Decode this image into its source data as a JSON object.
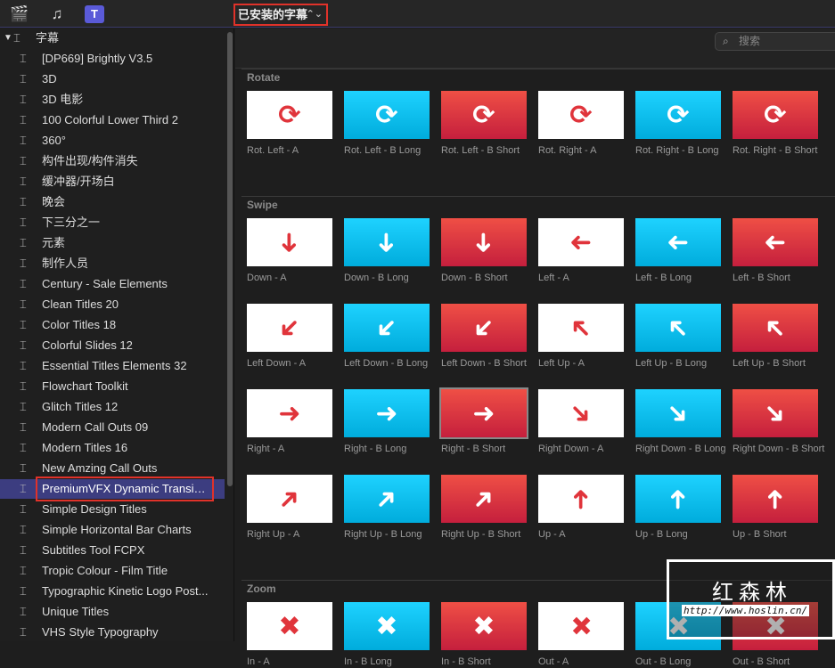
{
  "toolbar": {
    "icons": [
      "clapper-icon",
      "music-photo-icon",
      "titles-icon"
    ],
    "library_select": "已安装的字幕"
  },
  "sidebar": {
    "root": "字幕",
    "selected_index": 21,
    "items": [
      "[DP669] Brightly V3.5",
      "3D",
      "3D 电影",
      "100 Colorful Lower Third 2",
      "360°",
      "构件出现/构件消失",
      "缓冲器/开场白",
      "晚会",
      "下三分之一",
      "元素",
      "制作人员",
      "Century - Sale Elements",
      "Clean Titles 20",
      "Color Titles 18",
      "Colorful Slides 12",
      "Essential Titles Elements 32",
      "Flowchart Toolkit",
      "Glitch Titles 12",
      "Modern Call Outs 09",
      "Modern Titles 16",
      "New Amzing Call Outs",
      "PremiumVFX Dynamic Transiti...",
      "Simple Design Titles",
      "Simple Horizontal Bar Charts",
      "Subtitles Tool FCPX",
      "Tropic Colour - Film Title",
      "Typographic Kinetic Logo Post...",
      "Unique Titles",
      "VHS Style Typography"
    ]
  },
  "search": {
    "placeholder": "搜索"
  },
  "sections": [
    {
      "title": "Rotate",
      "items": [
        [
          "Rot. Left - A",
          "rotate"
        ],
        [
          "Rot. Left - B Long",
          "rotate"
        ],
        [
          "Rot. Left - B Short",
          "rotate"
        ],
        [
          "Rot. Right - A",
          "rotate"
        ],
        [
          "Rot. Right - B Long",
          "rotate"
        ],
        [
          "Rot. Right - B Short",
          "rotate"
        ]
      ]
    },
    {
      "title": "Swipe",
      "items": [
        [
          "Down - A",
          "down"
        ],
        [
          "Down - B Long",
          "down"
        ],
        [
          "Down - B Short",
          "down"
        ],
        [
          "Left - A",
          "left"
        ],
        [
          "Left - B Long",
          "left"
        ],
        [
          "Left - B Short",
          "left"
        ],
        [
          "Left Down - A",
          "left-down"
        ],
        [
          "Left Down - B Long",
          "left-down"
        ],
        [
          "Left Down - B Short",
          "left-down"
        ],
        [
          "Left Up - A",
          "left-up"
        ],
        [
          "Left Up - B Long",
          "left-up"
        ],
        [
          "Left Up - B Short",
          "left-up"
        ],
        [
          "Right - A",
          "right"
        ],
        [
          "Right - B Long",
          "right"
        ],
        [
          "Right - B Short",
          "right"
        ],
        [
          "Right Down - A",
          "right-down"
        ],
        [
          "Right Down - B Long",
          "right-down"
        ],
        [
          "Right Down - B Short",
          "right-down"
        ],
        [
          "Right Up - A",
          "right-up"
        ],
        [
          "Right Up - B Long",
          "right-up"
        ],
        [
          "Right Up - B Short",
          "right-up"
        ],
        [
          "Up - A",
          "up"
        ],
        [
          "Up - B Long",
          "up"
        ],
        [
          "Up - B Short",
          "up"
        ]
      ]
    },
    {
      "title": "Zoom",
      "items": [
        [
          "In - A",
          "in"
        ],
        [
          "In - B Long",
          "in"
        ],
        [
          "In - B Short",
          "in"
        ],
        [
          "Out - A",
          "out"
        ],
        [
          "Out - B Long",
          "out"
        ],
        [
          "Out - B Short",
          "out"
        ]
      ]
    }
  ],
  "watermark": {
    "name": "红森林",
    "url": "http://www.hoslin.cn/"
  }
}
